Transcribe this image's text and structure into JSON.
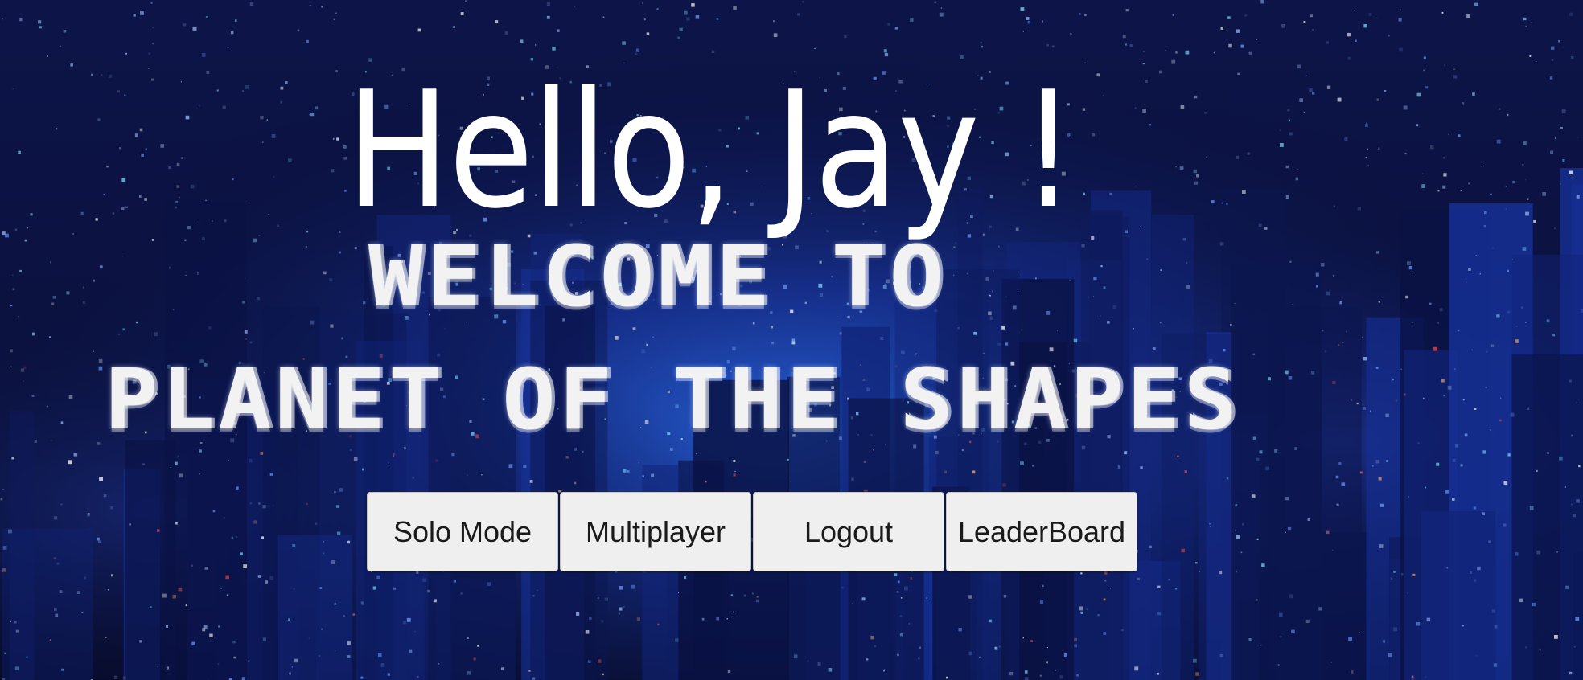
{
  "greeting": "Hello, Jay !",
  "banner": {
    "line1": "WELCOME TO",
    "line2": "PLANET OF THE SHAPES"
  },
  "buttons": {
    "solo": "Solo Mode",
    "multiplayer": "Multiplayer",
    "logout": "Logout",
    "leaderboard": "LeaderBoard"
  },
  "colors": {
    "background_base": "#0a0f3a",
    "city_glow": "#1e46c8",
    "text": "#ffffff",
    "button_bg": "#efefef",
    "button_text": "#1a1a1a"
  }
}
